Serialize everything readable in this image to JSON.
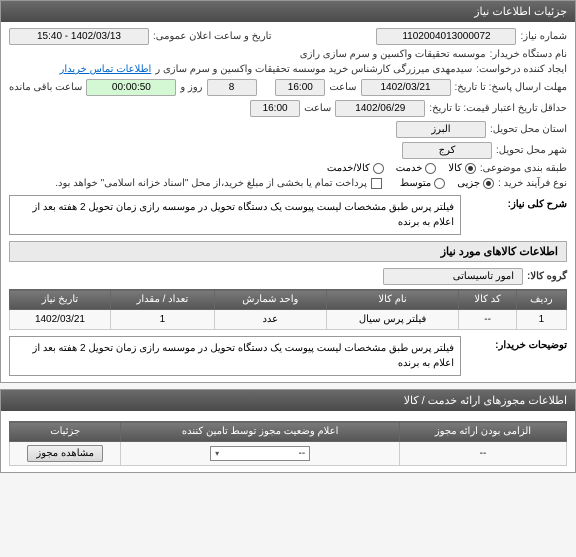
{
  "panel1": {
    "title": "جزئیات اطلاعات نیاز",
    "need_number_label": "شماره نیاز:",
    "need_number": "1102004013000072",
    "announce_label": "تاریخ و ساعت اعلان عمومی:",
    "announce_value": "1402/03/13 - 15:40",
    "buyer_label": "نام دستگاه خریدار:",
    "buyer_value": "موسسه تحقیقات واکسین و سرم سازی رازی",
    "creator_label": "ایجاد کننده درخواست:",
    "creator_value": "سیدمهدی میرزرگی کارشناس خرید موسسه تحقیقات واکسین و سرم سازی ر",
    "contact_link": "اطلاعات تماس خریدار",
    "deadline_label": "مهلت ارسال پاسخ: تا تاریخ:",
    "deadline_date": "1402/03/21",
    "deadline_hour_label": "ساعت",
    "deadline_hour": "16:00",
    "days_value": "8",
    "days_label": "روز و",
    "timer": "00:00:50",
    "timer_label": "ساعت باقی مانده",
    "min_credit_label": "حداقل تاریخ اعتبار قیمت: تا تاریخ:",
    "min_credit_date": "1402/06/29",
    "min_credit_hour": "16:00",
    "delivery_province_label": "استان محل تحویل:",
    "delivery_province": "البرز",
    "delivery_city_label": "شهر محل تحویل:",
    "delivery_city": "کرج",
    "subject_class_label": "طبقه بندی موضوعی:",
    "radio_kala": "کالا",
    "radio_khadamat": "خدمت",
    "radio_kala_khadamat": "کالا/خدمت",
    "purchase_type_label": "نوع فرآیند خرید :",
    "radio_jozee": "جزیی",
    "radio_motavaset": "متوسط",
    "payment_note": "پرداخت تمام یا بخشی از مبلغ خرید،از محل \"اسناد خزانه اسلامی\" خواهد بود.",
    "general_desc_label": "شرح کلی نیاز:",
    "general_desc": "فیلتر پرس طبق مشخصات لیست پیوست یک دستگاه تحویل در موسسه رازی زمان تحویل 2 هفته بعد از اعلام به برنده"
  },
  "panel2": {
    "title": "اطلاعات کالاهای مورد نیاز",
    "group_label": "گروه کالا:",
    "group_value": "امور تاسیساتی",
    "table": {
      "headers": [
        "ردیف",
        "کد کالا",
        "نام کالا",
        "واحد شمارش",
        "تعداد / مقدار",
        "تاریخ نیاز"
      ],
      "rows": [
        {
          "radif": "1",
          "code": "--",
          "name": "فیلتر پرس سیال",
          "unit": "عدد",
          "qty": "1",
          "date": "1402/03/21"
        }
      ]
    },
    "buyer_notes_label": "توضیحات خریدار:",
    "buyer_notes": "فیلتر پرس طبق مشخصات لیست پیوست یک دستگاه تحویل در موسسه رازی زمان تحویل 2 هفته بعد از اعلام به برنده"
  },
  "panel3": {
    "title": "اطلاعات مجوزهای ارائه خدمت / کالا",
    "table": {
      "headers": [
        "الزامی بودن ارائه مجوز",
        "اعلام وضعیت مجوز توسط تامین کننده",
        "جزئیات"
      ],
      "row": {
        "required": "--",
        "status_placeholder": "--",
        "detail_btn": "مشاهده مجوز"
      }
    }
  }
}
